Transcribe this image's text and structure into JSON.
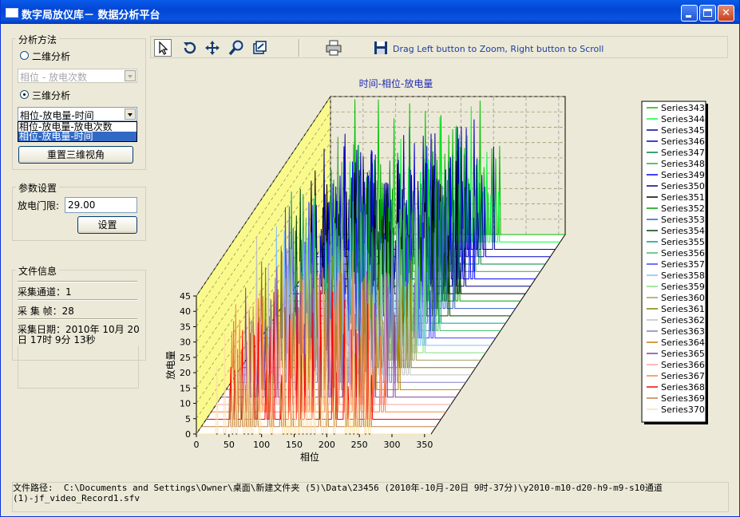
{
  "window": {
    "title": "数字局放仪库－ 数据分析平台"
  },
  "sidebar": {
    "method_group": {
      "label": "分析方法",
      "radio_2d": "二维分析",
      "combo_2d_value": "相位 - 放电次数",
      "radio_3d": "三维分析",
      "combo_3d_value": "相位-放电量-时间",
      "dropdown_options": [
        "相位-放电量-放电次数",
        "相位-放电量-时间"
      ],
      "selected_option": 1,
      "reset_button": "重置三维视角"
    },
    "param_group": {
      "label": "参数设置",
      "threshold_label": "放电门限:",
      "threshold_value": "29.00",
      "set_button": "设置"
    },
    "file_group": {
      "label": "文件信息",
      "channel": "采集通道：1",
      "frames": "采 集 帧：28",
      "date_line1": "采集日期：2010年 10月 20",
      "date_line2": "日 17时 9分 13秒"
    }
  },
  "toolbar": {
    "hint": "Drag Left button to Zoom, Right button to Scroll",
    "icons": [
      "pointer-icon",
      "rotate-icon",
      "move-icon",
      "zoom-icon",
      "copy-icon",
      "print-icon",
      "save-icon"
    ]
  },
  "chart_data": {
    "type": "line",
    "title": "时间-相位-放电量",
    "xlabel": "相位",
    "ylabel": "放电量",
    "xlim": [
      0,
      360
    ],
    "ylim": [
      0,
      45
    ],
    "xticks": [
      "0",
      "50",
      "100",
      "150",
      "200",
      "250",
      "300",
      "350"
    ],
    "yticks": [
      "0",
      "5",
      "10",
      "15",
      "20",
      "25",
      "30",
      "35",
      "40",
      "45"
    ],
    "projection": "3d",
    "legend_position": "right",
    "series": [
      {
        "name": "Series343",
        "color": "#00c000"
      },
      {
        "name": "Series344",
        "color": "#00ff40"
      },
      {
        "name": "Series345",
        "color": "#0000a0"
      },
      {
        "name": "Series346",
        "color": "#0000c8"
      },
      {
        "name": "Series347",
        "color": "#008040"
      },
      {
        "name": "Series348",
        "color": "#40a040"
      },
      {
        "name": "Series349",
        "color": "#0000ff"
      },
      {
        "name": "Series350",
        "color": "#000080"
      },
      {
        "name": "Series351",
        "color": "#000000"
      },
      {
        "name": "Series352",
        "color": "#00a000"
      },
      {
        "name": "Series353",
        "color": "#3060c0"
      },
      {
        "name": "Series354",
        "color": "#004000"
      },
      {
        "name": "Series355",
        "color": "#00a080"
      },
      {
        "name": "Series356",
        "color": "#40c060"
      },
      {
        "name": "Series357",
        "color": "#4040ff"
      },
      {
        "name": "Series358",
        "color": "#80c0ff"
      },
      {
        "name": "Series359",
        "color": "#80e080"
      },
      {
        "name": "Series360",
        "color": "#a0a060"
      },
      {
        "name": "Series361",
        "color": "#808000"
      },
      {
        "name": "Series362",
        "color": "#c0c0c0"
      },
      {
        "name": "Series363",
        "color": "#8080c0"
      },
      {
        "name": "Series364",
        "color": "#c08000"
      },
      {
        "name": "Series365",
        "color": "#8040a0"
      },
      {
        "name": "Series366",
        "color": "#ffa0a0"
      },
      {
        "name": "Series367",
        "color": "#ff8040"
      },
      {
        "name": "Series368",
        "color": "#ff0000"
      },
      {
        "name": "Series369",
        "color": "#c08040"
      },
      {
        "name": "Series370",
        "color": "#ffe0a0"
      }
    ]
  },
  "status": {
    "line1": "文件路径:  C:\\Documents and Settings\\Owner\\桌面\\新建文件夹 (5)\\Data\\23456 (2010年-10月-20日 9时-37分)\\y2010-m10-d20-h9-m9-s10通道",
    "line2": "(1)-jf_video_Record1.sfv"
  }
}
